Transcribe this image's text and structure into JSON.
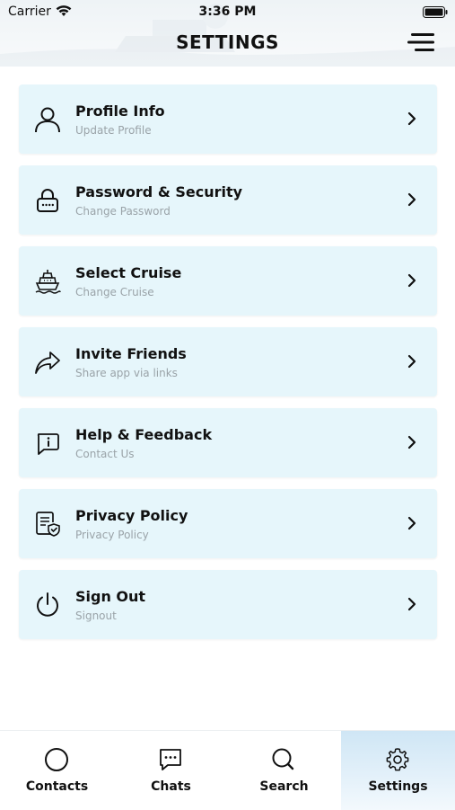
{
  "status_bar": {
    "carrier": "Carrier",
    "time": "3:36 PM"
  },
  "header": {
    "title": "SETTINGS",
    "menu_icon": "hamburger-menu-icon"
  },
  "settings_items": [
    {
      "label": "Profile Info",
      "subtitle": "Update Profile",
      "icon": "user-icon"
    },
    {
      "label": "Password & Security",
      "subtitle": "Change Password",
      "icon": "lock-icon"
    },
    {
      "label": "Select Cruise",
      "subtitle": "Change Cruise",
      "icon": "ship-icon"
    },
    {
      "label": "Invite Friends",
      "subtitle": "Share app via links",
      "icon": "share-icon"
    },
    {
      "label": "Help & Feedback",
      "subtitle": "Contact Us",
      "icon": "chat-info-icon"
    },
    {
      "label": "Privacy Policy",
      "subtitle": "Privacy Policy",
      "icon": "document-shield-icon"
    },
    {
      "label": "Sign Out",
      "subtitle": "Signout",
      "icon": "power-icon"
    }
  ],
  "tabs": [
    {
      "label": "Contacts",
      "icon": "circle-icon",
      "active": false
    },
    {
      "label": "Chats",
      "icon": "chat-icon",
      "active": false
    },
    {
      "label": "Search",
      "icon": "search-icon",
      "active": false
    },
    {
      "label": "Settings",
      "icon": "gear-icon",
      "active": true
    }
  ],
  "colors": {
    "row_background": "#e6f6fb",
    "active_tab": "#cfe6f5",
    "subtitle_text": "#9aa3a8"
  }
}
